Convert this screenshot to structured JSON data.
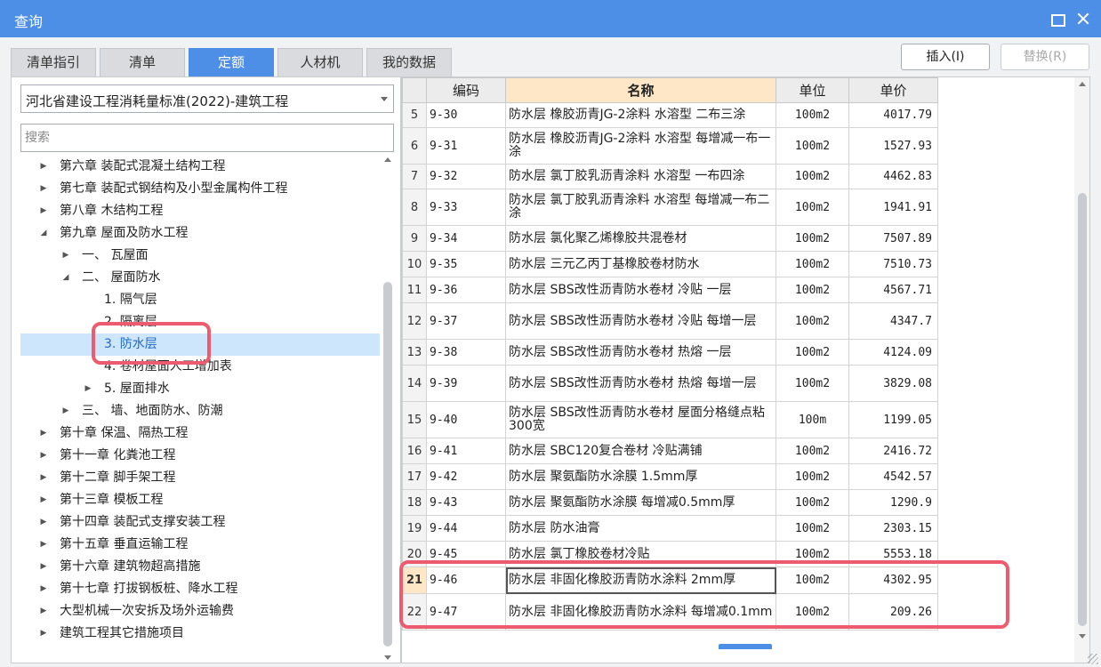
{
  "window": {
    "title": "查询"
  },
  "tabs": [
    {
      "label": "清单指引",
      "active": false
    },
    {
      "label": "清单",
      "active": false
    },
    {
      "label": "定额",
      "active": true
    },
    {
      "label": "人材机",
      "active": false
    },
    {
      "label": "我的数据",
      "active": false
    }
  ],
  "toolbar": {
    "insert_label": "插入(I)",
    "replace_label": "替换(R)"
  },
  "left": {
    "library_selected": "河北省建设工程消耗量标准(2022)-建筑工程",
    "search_placeholder": "搜索",
    "tree": [
      {
        "label": "第六章 装配式混凝土结构工程",
        "level": 0,
        "toggle": "collapsed"
      },
      {
        "label": "第七章 装配式钢结构及小型金属构件工程",
        "level": 0,
        "toggle": "collapsed"
      },
      {
        "label": "第八章 木结构工程",
        "level": 0,
        "toggle": "collapsed"
      },
      {
        "label": "第九章 屋面及防水工程",
        "level": 0,
        "toggle": "expanded"
      },
      {
        "label": "一、 瓦屋面",
        "level": 1,
        "toggle": "collapsed"
      },
      {
        "label": "二、 屋面防水",
        "level": 1,
        "toggle": "expanded"
      },
      {
        "label": "1. 隔气层",
        "level": 2,
        "toggle": "none"
      },
      {
        "label": "2. 隔离层",
        "level": 2,
        "toggle": "none"
      },
      {
        "label": "3. 防水层",
        "level": 2,
        "toggle": "none",
        "selected": true
      },
      {
        "label": "4. 卷材屋面人工增加表",
        "level": 2,
        "toggle": "none"
      },
      {
        "label": "5. 屋面排水",
        "level": 2,
        "toggle": "collapsed"
      },
      {
        "label": "三、 墙、地面防水、防潮",
        "level": 1,
        "toggle": "collapsed"
      },
      {
        "label": "第十章 保温、隔热工程",
        "level": 0,
        "toggle": "collapsed"
      },
      {
        "label": "第十一章 化粪池工程",
        "level": 0,
        "toggle": "collapsed"
      },
      {
        "label": "第十二章 脚手架工程",
        "level": 0,
        "toggle": "collapsed"
      },
      {
        "label": "第十三章 模板工程",
        "level": 0,
        "toggle": "collapsed"
      },
      {
        "label": "第十四章 装配式支撑安装工程",
        "level": 0,
        "toggle": "collapsed"
      },
      {
        "label": "第十五章 垂直运输工程",
        "level": 0,
        "toggle": "collapsed"
      },
      {
        "label": "第十六章 建筑物超高措施",
        "level": 0,
        "toggle": "collapsed"
      },
      {
        "label": "第十七章 打拔钢板桩、降水工程",
        "level": 0,
        "toggle": "collapsed"
      },
      {
        "label": "大型机械一次安拆及场外运输费",
        "level": 0,
        "toggle": "collapsed"
      },
      {
        "label": "建筑工程其它措施项目",
        "level": 0,
        "toggle": "collapsed"
      }
    ]
  },
  "table": {
    "columns": [
      "编码",
      "名称",
      "单位",
      "单价"
    ],
    "rows": [
      {
        "idx": "5",
        "code": "9-30",
        "name": "防水层 橡胶沥青JG-2涂料 水溶型 二布三涂",
        "unit": "100m2",
        "price": "4017.79"
      },
      {
        "idx": "6",
        "code": "9-31",
        "name": "防水层 橡胶沥青JG-2涂料 水溶型 每增减一布一涂",
        "unit": "100m2",
        "price": "1527.93"
      },
      {
        "idx": "7",
        "code": "9-32",
        "name": "防水层 氯丁胶乳沥青涂料 水溶型 一布四涂",
        "unit": "100m2",
        "price": "4462.83"
      },
      {
        "idx": "8",
        "code": "9-33",
        "name": "防水层 氯丁胶乳沥青涂料 水溶型 每增减一布二涂",
        "unit": "100m2",
        "price": "1941.91"
      },
      {
        "idx": "9",
        "code": "9-34",
        "name": "防水层 氯化聚乙烯橡胶共混卷材",
        "unit": "100m2",
        "price": "7507.89"
      },
      {
        "idx": "10",
        "code": "9-35",
        "name": "防水层 三元乙丙丁基橡胶卷材防水",
        "unit": "100m2",
        "price": "7510.73"
      },
      {
        "idx": "11",
        "code": "9-36",
        "name": "防水层 SBS改性沥青防水卷材 冷贴 一层",
        "unit": "100m2",
        "price": "4567.71"
      },
      {
        "idx": "12",
        "code": "9-37",
        "name": "防水层 SBS改性沥青防水卷材 冷贴 每增一层",
        "unit": "100m2",
        "price": "4347.7"
      },
      {
        "idx": "13",
        "code": "9-38",
        "name": "防水层 SBS改性沥青防水卷材 热熔 一层",
        "unit": "100m2",
        "price": "4124.09"
      },
      {
        "idx": "14",
        "code": "9-39",
        "name": "防水层 SBS改性沥青防水卷材 热熔 每增一层",
        "unit": "100m2",
        "price": "3829.08"
      },
      {
        "idx": "15",
        "code": "9-40",
        "name": "防水层 SBS改性沥青防水卷材 屋面分格缝点粘300宽",
        "unit": "100m",
        "price": "1199.05"
      },
      {
        "idx": "16",
        "code": "9-41",
        "name": "防水层 SBC120复合卷材 冷贴满铺",
        "unit": "100m2",
        "price": "2416.72"
      },
      {
        "idx": "17",
        "code": "9-42",
        "name": "防水层 聚氨酯防水涂膜 1.5mm厚",
        "unit": "100m2",
        "price": "4542.57"
      },
      {
        "idx": "18",
        "code": "9-43",
        "name": "防水层 聚氨酯防水涂膜 每增减0.5mm厚",
        "unit": "100m2",
        "price": "1290.9"
      },
      {
        "idx": "19",
        "code": "9-44",
        "name": "防水层 防水油膏",
        "unit": "100m2",
        "price": "2303.15"
      },
      {
        "idx": "20",
        "code": "9-45",
        "name": "防水层 氯丁橡胶卷材冷贴",
        "unit": "100m2",
        "price": "5553.18"
      },
      {
        "idx": "21",
        "code": "9-46",
        "name": "防水层 非固化橡胶沥青防水涂料 2mm厚",
        "unit": "100m2",
        "price": "4302.95",
        "active": true
      },
      {
        "idx": "22",
        "code": "9-47",
        "name": "防水层 非固化橡胶沥青防水涂料 每增减0.1mm",
        "unit": "100m2",
        "price": "209.26"
      }
    ]
  },
  "colors": {
    "accent": "#4d8fe6",
    "highlight": "#ec5b6e",
    "header_highlight": "#fde7c6",
    "selected_row": "#cde6fb"
  }
}
